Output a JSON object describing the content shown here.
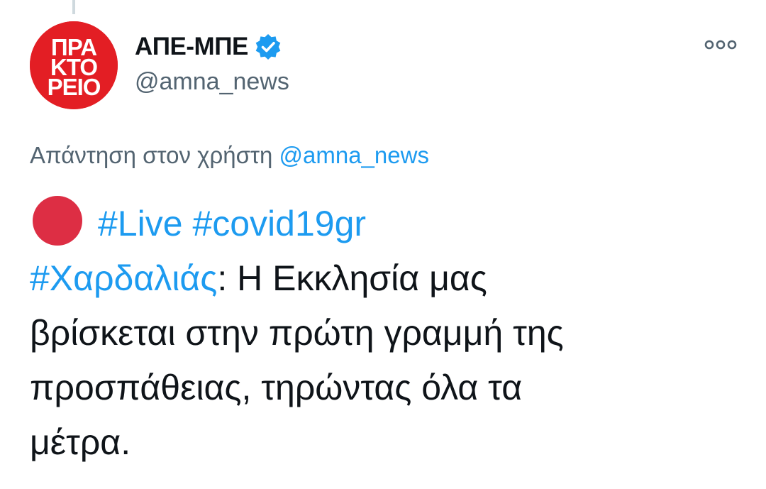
{
  "account": {
    "display_name": "ΑΠΕ-ΜΠΕ",
    "handle": "@amna_news",
    "avatar_text": [
      "ΠΡΑ",
      "ΚΤΟ",
      "ΡΕΙΟ"
    ],
    "verified": true
  },
  "reply": {
    "prefix": "Απάντηση στον χρήστη",
    "target": "@amna_news"
  },
  "tweet": {
    "emoji": "red-circle",
    "hashtags_line": [
      "#Live",
      "#covid19gr"
    ],
    "hashtag_inline": "#Χαρδαλιάς",
    "line1_rest": ": Η Εκκλησία μας",
    "line2": "βρίσκεται στην πρώτη γραμμή της",
    "line3": "προσπάθειας, τηρώντας όλα τα",
    "line4": "μέτρα."
  },
  "icons": {
    "more": "more-options-icon",
    "verified": "verified-badge-icon"
  },
  "colors": {
    "link": "#1d9bf0",
    "secondary_text": "#536471",
    "avatar_red": "#e31e24",
    "red_circle": "#dd2e44"
  }
}
